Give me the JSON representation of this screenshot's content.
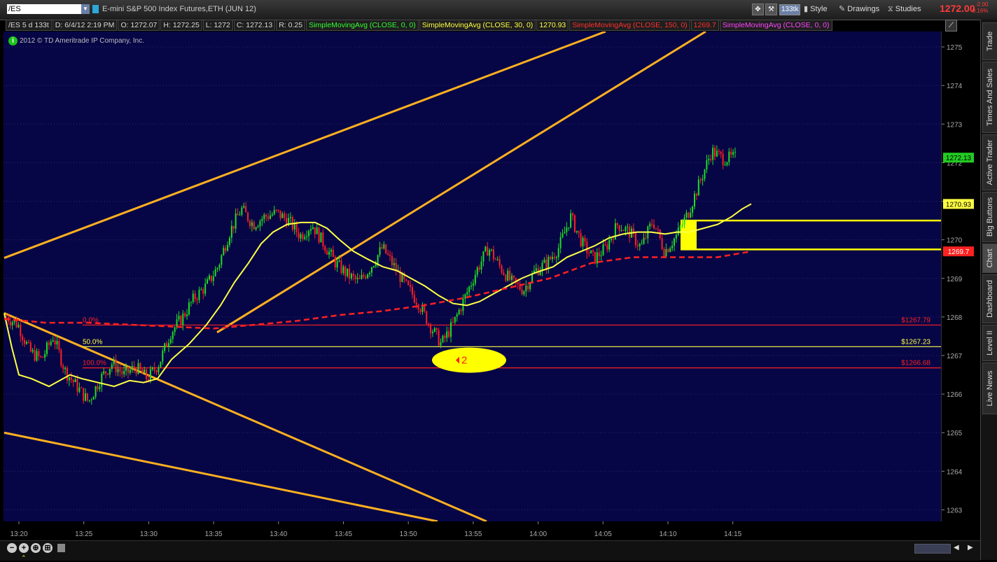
{
  "header": {
    "symbol": "/ES",
    "description": "E-mini S&P 500 Index Futures,ETH (JUN 12)",
    "tick_badge": "133tk",
    "style_label": "Style",
    "drawings_label": "Drawings",
    "studies_label": "Studies",
    "last_price": "1272.00",
    "net_change": "-2.00",
    "pct_change": "-0.16%"
  },
  "info": {
    "cells": [
      {
        "text": "/ES 5 d 133t",
        "color": "#d8d8d8"
      },
      {
        "text": "D: 6/4/12 2:19 PM",
        "color": "#d8d8d8"
      },
      {
        "text": "O: 1272.07",
        "color": "#d8d8d8"
      },
      {
        "text": "H: 1272.25",
        "color": "#d8d8d8"
      },
      {
        "text": "L: 1272",
        "color": "#d8d8d8"
      },
      {
        "text": "C: 1272.13",
        "color": "#d8d8d8"
      },
      {
        "text": "R: 0.25",
        "color": "#d8d8d8"
      },
      {
        "text": "SimpleMovingAvg (CLOSE, 0, 0)",
        "color": "#33ff33"
      },
      {
        "text": "SimpleMovingAvg (CLOSE, 30, 0)",
        "color": "#ffff44"
      },
      {
        "text": "1270.93",
        "color": "#ffff44"
      },
      {
        "text": "SimpleMovingAvg (CLOSE, 150, 0)",
        "color": "#ff3030"
      },
      {
        "text": "1269.7",
        "color": "#ff3030"
      },
      {
        "text": "SimpleMovingAvg (CLOSE, 0, 0)",
        "color": "#ff44ff"
      }
    ],
    "copyright": "2012 © TD Ameritrade IP Company, Inc."
  },
  "sidetabs": [
    {
      "label": "Trade",
      "active": false
    },
    {
      "label": "Times And Sales",
      "active": false
    },
    {
      "label": "Active Trader",
      "active": false
    },
    {
      "label": "Big Buttons",
      "active": false
    },
    {
      "label": "Chart",
      "active": true
    },
    {
      "label": "Dashboard",
      "active": false
    },
    {
      "label": "Level II",
      "active": false
    },
    {
      "label": "Live News",
      "active": false
    }
  ],
  "chart_data": {
    "type": "candlestick",
    "ylim": [
      1262.7,
      1275.4
    ],
    "y_ticks": [
      1263,
      1264,
      1265,
      1266,
      1267,
      1268,
      1269,
      1270,
      1271,
      1272,
      1273,
      1274,
      1275
    ],
    "x_ticks": [
      "13:20",
      "13:25",
      "13:30",
      "13:35",
      "13:40",
      "13:45",
      "13:50",
      "13:55",
      "14:00",
      "14:05",
      "14:10",
      "14:15"
    ],
    "colors": {
      "up": "#22dd22",
      "down": "#ff2020",
      "sma30": "#ffff44",
      "sma150": "#ff2020",
      "trend": "#ffb020",
      "fib": "#ff2020",
      "box": "#ffff00"
    },
    "close_path": [
      1268.0,
      1267.8,
      1267.1,
      1266.9,
      1267.5,
      1266.6,
      1266.2,
      1265.8,
      1266.4,
      1266.8,
      1266.5,
      1266.7,
      1266.4,
      1266.8,
      1267.6,
      1268.0,
      1268.5,
      1268.8,
      1269.3,
      1270.2,
      1270.8,
      1270.4,
      1270.6,
      1270.7,
      1270.5,
      1270.1,
      1270.4,
      1269.9,
      1269.4,
      1269.1,
      1268.9,
      1269.3,
      1269.8,
      1269.3,
      1268.8,
      1268.4,
      1267.8,
      1267.3,
      1267.8,
      1268.5,
      1269.2,
      1269.8,
      1269.3,
      1268.9,
      1268.7,
      1269.2,
      1269.4,
      1269.8,
      1270.6,
      1269.9,
      1269.5,
      1269.8,
      1270.4,
      1270.2,
      1269.8,
      1270.5,
      1269.7,
      1270.1,
      1270.7,
      1271.5,
      1272.3,
      1272.1,
      1272.13
    ],
    "sma30": [
      [
        1,
        1268.1
      ],
      [
        12,
        1267.2
      ],
      [
        22,
        1266.5
      ],
      [
        40,
        1266.4
      ],
      [
        65,
        1266.2
      ],
      [
        95,
        1266.5
      ],
      [
        112,
        1266.4
      ],
      [
        135,
        1266.3
      ],
      [
        158,
        1266.2
      ],
      [
        180,
        1266.35
      ],
      [
        200,
        1266.3
      ],
      [
        220,
        1266.4
      ],
      [
        240,
        1266.9
      ],
      [
        265,
        1267.3
      ],
      [
        290,
        1267.8
      ],
      [
        310,
        1268.3
      ],
      [
        330,
        1268.9
      ],
      [
        350,
        1269.4
      ],
      [
        368,
        1269.9
      ],
      [
        385,
        1270.2
      ],
      [
        405,
        1270.4
      ],
      [
        425,
        1270.45
      ],
      [
        445,
        1270.45
      ],
      [
        462,
        1270.3
      ],
      [
        480,
        1270.0
      ],
      [
        500,
        1269.7
      ],
      [
        520,
        1269.5
      ],
      [
        542,
        1269.3
      ],
      [
        562,
        1269.2
      ],
      [
        582,
        1269.0
      ],
      [
        602,
        1268.8
      ],
      [
        622,
        1268.55
      ],
      [
        642,
        1268.35
      ],
      [
        662,
        1268.3
      ],
      [
        680,
        1268.4
      ],
      [
        700,
        1268.6
      ],
      [
        720,
        1268.8
      ],
      [
        740,
        1269.0
      ],
      [
        760,
        1269.15
      ],
      [
        785,
        1269.3
      ],
      [
        805,
        1269.55
      ],
      [
        825,
        1269.7
      ],
      [
        845,
        1269.85
      ],
      [
        865,
        1270.05
      ],
      [
        885,
        1270.15
      ],
      [
        905,
        1270.2
      ],
      [
        925,
        1270.2
      ],
      [
        945,
        1270.15
      ],
      [
        962,
        1270.2
      ],
      [
        980,
        1270.2
      ],
      [
        1000,
        1270.3
      ],
      [
        1020,
        1270.4
      ],
      [
        1040,
        1270.6
      ],
      [
        1055,
        1270.8
      ],
      [
        1068,
        1270.93
      ]
    ],
    "sma150": [
      [
        1,
        1267.95
      ],
      [
        60,
        1267.85
      ],
      [
        120,
        1267.85
      ],
      [
        180,
        1267.8
      ],
      [
        240,
        1267.75
      ],
      [
        300,
        1267.7
      ],
      [
        360,
        1267.8
      ],
      [
        420,
        1267.9
      ],
      [
        480,
        1268.05
      ],
      [
        540,
        1268.15
      ],
      [
        600,
        1268.3
      ],
      [
        660,
        1268.5
      ],
      [
        720,
        1268.75
      ],
      [
        780,
        1269.0
      ],
      [
        840,
        1269.4
      ],
      [
        900,
        1269.55
      ],
      [
        960,
        1269.55
      ],
      [
        1020,
        1269.55
      ],
      [
        1068,
        1269.7
      ]
    ],
    "trendlines": [
      {
        "x1": 1,
        "y1": 1269.53,
        "x2": 860,
        "y2": 1275.4
      },
      {
        "x1": 305,
        "y1": 1267.6,
        "x2": 1003,
        "y2": 1275.4
      },
      {
        "x1": 1,
        "y1": 1268.1,
        "x2": 690,
        "y2": 1262.7
      },
      {
        "x1": 1,
        "y1": 1265.0,
        "x2": 620,
        "y2": 1262.7
      }
    ],
    "fib": [
      {
        "pct": "0.0%",
        "value": 1267.79,
        "label": "$1267.79",
        "color": "#ff2020"
      },
      {
        "pct": "50.0%",
        "value": 1267.23,
        "label": "$1267.23",
        "color": "#ffff44"
      },
      {
        "pct": "100.0%",
        "value": 1266.68,
        "label": "$1266.68",
        "color": "#ff2020"
      }
    ],
    "fib_x_start": 113,
    "box": {
      "x1": 967,
      "x2": 990,
      "y_top": 1270.5,
      "y_bottom": 1269.75,
      "line_x2": 1339
    },
    "marker": {
      "x": 650,
      "y": 1266.88,
      "label": "2"
    },
    "price_tags": [
      {
        "value": 1272.13,
        "label": "1272.13",
        "bg": "#22cc22",
        "fg": "#000"
      },
      {
        "value": 1270.93,
        "label": "1270.93",
        "bg": "#ffff44",
        "fg": "#000"
      },
      {
        "value": 1269.7,
        "label": "1269.7",
        "bg": "#ff2020",
        "fg": "#fff"
      }
    ]
  }
}
